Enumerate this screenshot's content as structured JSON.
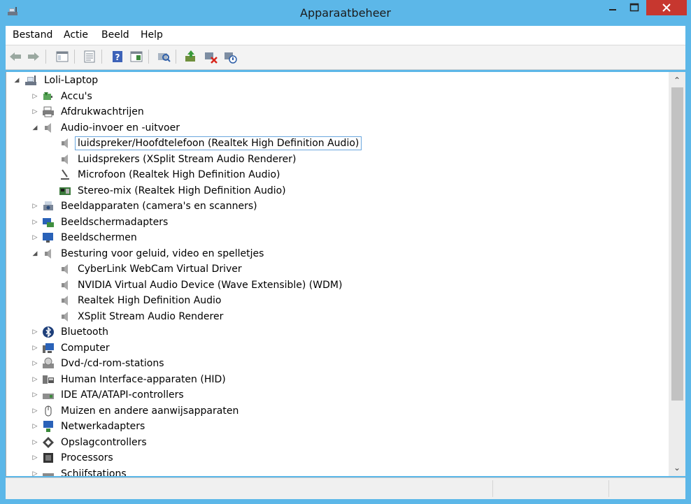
{
  "window": {
    "title": "Apparaatbeheer"
  },
  "menu": [
    "Bestand",
    "Actie",
    "Beeld",
    "Help"
  ],
  "toolbar": {
    "buttons": [
      "back-icon",
      "forward-icon",
      "console-tree-icon",
      "properties-icon",
      "help-icon",
      "view-icon",
      "scan-hardware-icon",
      "update-driver-icon",
      "uninstall-icon",
      "disable-device-icon"
    ]
  },
  "tree": {
    "root": "Loli-Laptop",
    "items": [
      {
        "label": "Accu's",
        "icon": "battery-icon",
        "expander": "collapsed"
      },
      {
        "label": "Afdrukwachtrijen",
        "icon": "printer-icon",
        "expander": "collapsed"
      },
      {
        "label": "Audio-invoer en -uitvoer",
        "icon": "speaker-icon",
        "expander": "expanded"
      },
      {
        "label": "luidspreker/Hoofdtelefoon (Realtek High Definition Audio)",
        "icon": "speaker-icon",
        "level": 2,
        "selected": true
      },
      {
        "label": "Luidsprekers (XSplit  Stream  Audio  Renderer)",
        "icon": "speaker-icon",
        "level": 2
      },
      {
        "label": "Microfoon (Realtek High Definition Audio)",
        "icon": "microphone-icon",
        "level": 2
      },
      {
        "label": "Stereo-mix (Realtek High Definition Audio)",
        "icon": "audio-board-icon",
        "level": 2
      },
      {
        "label": "Beeldapparaten (camera's en scanners)",
        "icon": "camera-icon",
        "expander": "collapsed"
      },
      {
        "label": "Beeldschermadapters",
        "icon": "display-adapter-icon",
        "expander": "collapsed"
      },
      {
        "label": "Beeldschermen",
        "icon": "monitor-icon",
        "expander": "collapsed"
      },
      {
        "label": "Besturing voor geluid, video en spelletjes",
        "icon": "speaker-icon",
        "expander": "expanded"
      },
      {
        "label": "CyberLink WebCam Virtual Driver",
        "icon": "speaker-icon",
        "level": 2
      },
      {
        "label": "NVIDIA Virtual Audio Device (Wave Extensible) (WDM)",
        "icon": "speaker-icon",
        "level": 2
      },
      {
        "label": "Realtek High Definition Audio",
        "icon": "speaker-icon",
        "level": 2
      },
      {
        "label": "XSplit  Stream  Audio  Renderer",
        "icon": "speaker-icon",
        "level": 2
      },
      {
        "label": "Bluetooth",
        "icon": "bluetooth-icon",
        "expander": "collapsed"
      },
      {
        "label": "Computer",
        "icon": "computer-icon",
        "expander": "collapsed"
      },
      {
        "label": "Dvd-/cd-rom-stations",
        "icon": "dvd-drive-icon",
        "expander": "collapsed"
      },
      {
        "label": "Human Interface-apparaten (HID)",
        "icon": "hid-icon",
        "expander": "collapsed"
      },
      {
        "label": "IDE ATA/ATAPI-controllers",
        "icon": "ide-controller-icon",
        "expander": "collapsed"
      },
      {
        "label": "Muizen en andere aanwijsapparaten",
        "icon": "mouse-icon",
        "expander": "collapsed"
      },
      {
        "label": "Netwerkadapters",
        "icon": "network-adapter-icon",
        "expander": "collapsed"
      },
      {
        "label": "Opslagcontrollers",
        "icon": "storage-controller-icon",
        "expander": "collapsed"
      },
      {
        "label": "Processors",
        "icon": "processor-icon",
        "expander": "collapsed"
      },
      {
        "label": "Schijfstations",
        "icon": "disk-drive-icon",
        "expander": "collapsed"
      }
    ]
  },
  "colors": {
    "titlebar": "#5cb7e8",
    "close": "#c7372f",
    "selection_border": "#6aa7de"
  }
}
